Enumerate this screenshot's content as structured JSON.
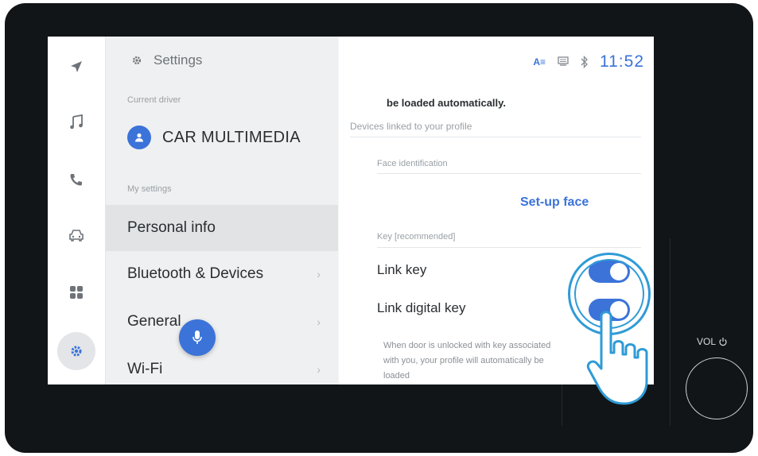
{
  "nav_rail": {
    "icons": [
      "navigation-icon",
      "music-icon",
      "phone-icon",
      "car-icon",
      "apps-icon",
      "settings-icon"
    ]
  },
  "left_panel": {
    "title": "Settings",
    "current_driver_label": "Current driver",
    "driver_name": "CAR MULTIMEDIA",
    "my_settings_label": "My settings",
    "menu": [
      {
        "label": "Personal info"
      },
      {
        "label": "Bluetooth & Devices"
      },
      {
        "label": "General"
      },
      {
        "label": "Wi-Fi"
      }
    ]
  },
  "status_bar": {
    "time": "11:52",
    "accent": "#3b73d9"
  },
  "right_panel": {
    "top_text": "be loaded automatically.",
    "devices_label": "Devices linked to your profile",
    "face_label": "Face identification",
    "setup_face": "Set-up face",
    "key_label": "Key [recommended]",
    "link_key": {
      "label": "Link key",
      "on": true
    },
    "link_digital_key": {
      "label": "Link digital key",
      "on": true
    },
    "description_line1": "When door is unlocked with key associated",
    "description_line2": "with you, your profile will automatically be",
    "description_line3": "loaded"
  },
  "hardware": {
    "vol_label": "VOL"
  }
}
